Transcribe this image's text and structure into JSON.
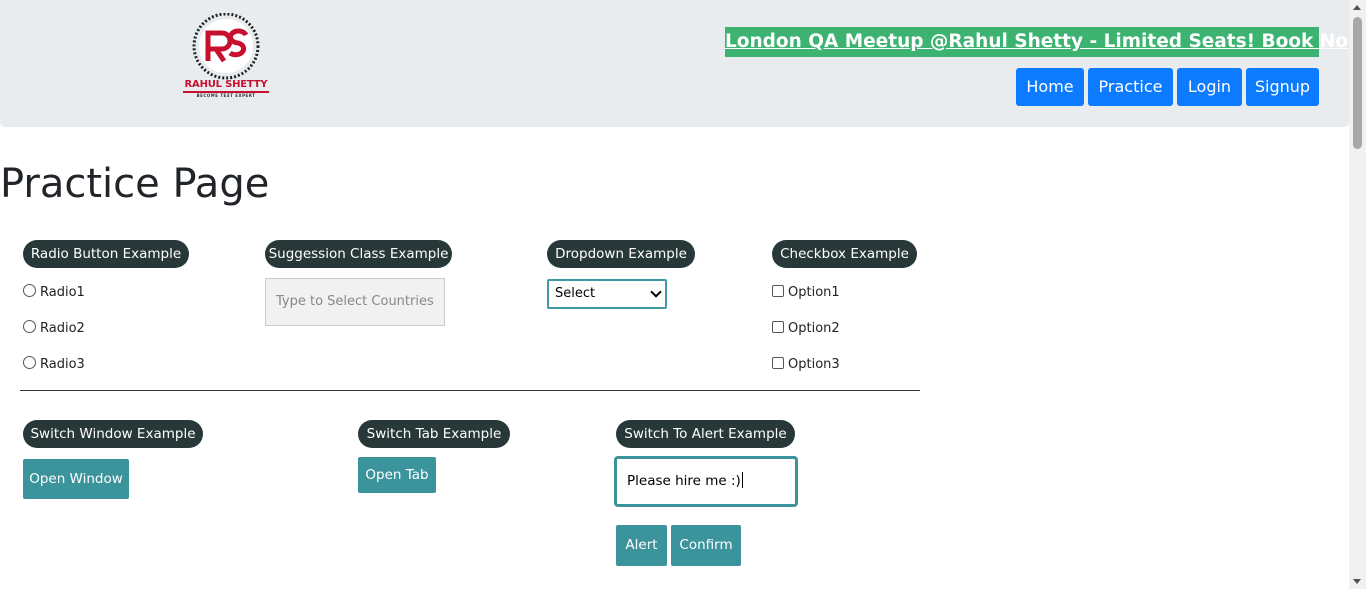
{
  "header": {
    "logo": {
      "name": "RAHUL SHETTY",
      "tagline": "BECOME TEST EXPERT"
    },
    "promo": "London QA Meetup @Rahul Shetty - Limited Seats! Book Now!",
    "nav": [
      {
        "label": "Home"
      },
      {
        "label": "Practice"
      },
      {
        "label": "Login"
      },
      {
        "label": "Signup"
      }
    ]
  },
  "page": {
    "title": "Practice Page"
  },
  "radio_section": {
    "legend": "Radio Button Example",
    "options": [
      "Radio1",
      "Radio2",
      "Radio3"
    ]
  },
  "suggestion_section": {
    "legend": "Suggession Class Example",
    "placeholder": "Type to Select Countries"
  },
  "dropdown_section": {
    "legend": "Dropdown Example",
    "selected": "Select"
  },
  "checkbox_section": {
    "legend": "Checkbox Example",
    "options": [
      "Option1",
      "Option2",
      "Option3"
    ]
  },
  "switch_window": {
    "legend": "Switch Window Example",
    "button": "Open Window"
  },
  "switch_tab": {
    "legend": "Switch Tab Example",
    "button": "Open Tab"
  },
  "alert_section": {
    "legend": "Switch To Alert Example",
    "input_value": "Please hire me :)",
    "alert_button": "Alert",
    "confirm_button": "Confirm"
  },
  "colors": {
    "header_bg": "#e9ecef",
    "promo_bg": "#3cb371",
    "nav_bg": "#0d7bff",
    "legend_bg": "#283838",
    "teal_button": "#3b939b",
    "logo_red": "#c8102e"
  }
}
